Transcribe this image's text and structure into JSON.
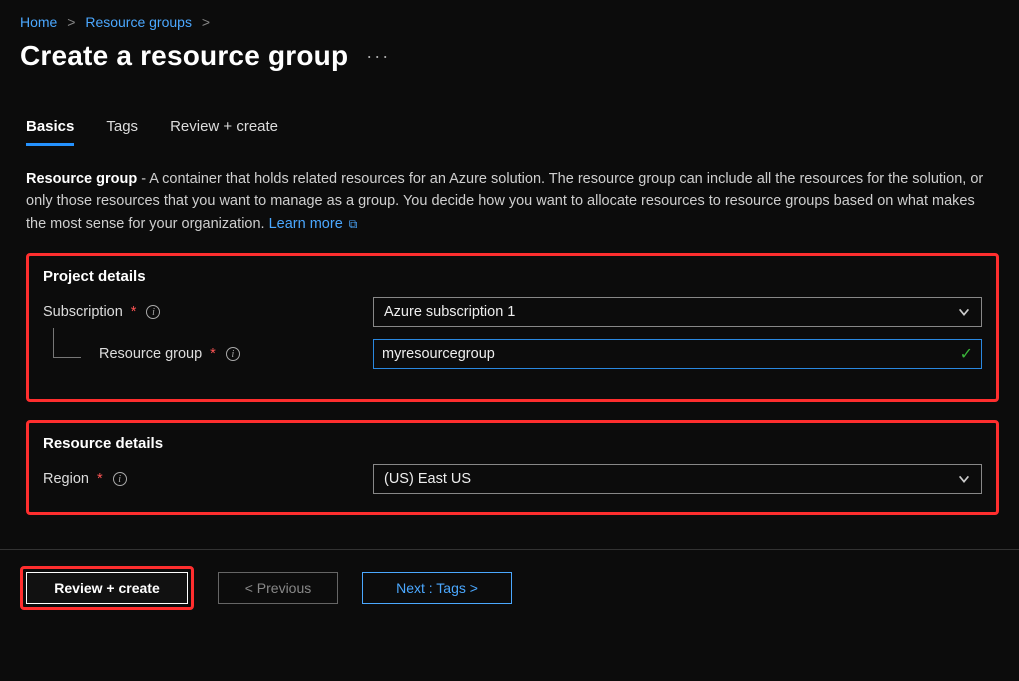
{
  "breadcrumb": {
    "home": "Home",
    "resource_groups": "Resource groups"
  },
  "page_title": "Create a resource group",
  "tabs": {
    "basics": "Basics",
    "tags": "Tags",
    "review": "Review + create"
  },
  "description": {
    "strong": "Resource group",
    "text": " - A container that holds related resources for an Azure solution. The resource group can include all the resources for the solution, or only those resources that you want to manage as a group. You decide how you want to allocate resources to resource groups based on what makes the most sense for your organization. ",
    "learn_more": "Learn more"
  },
  "project_details": {
    "heading": "Project details",
    "subscription_label": "Subscription",
    "subscription_value": "Azure subscription 1",
    "resource_group_label": "Resource group",
    "resource_group_value": "myresourcegroup"
  },
  "resource_details": {
    "heading": "Resource details",
    "region_label": "Region",
    "region_value": "(US) East US"
  },
  "buttons": {
    "review": "Review + create",
    "previous": "< Previous",
    "next": "Next : Tags >"
  },
  "symbols": {
    "star": "*",
    "info": "i",
    "check": "✓",
    "dots": "···",
    "ext": "⧉",
    "sep": ">"
  }
}
